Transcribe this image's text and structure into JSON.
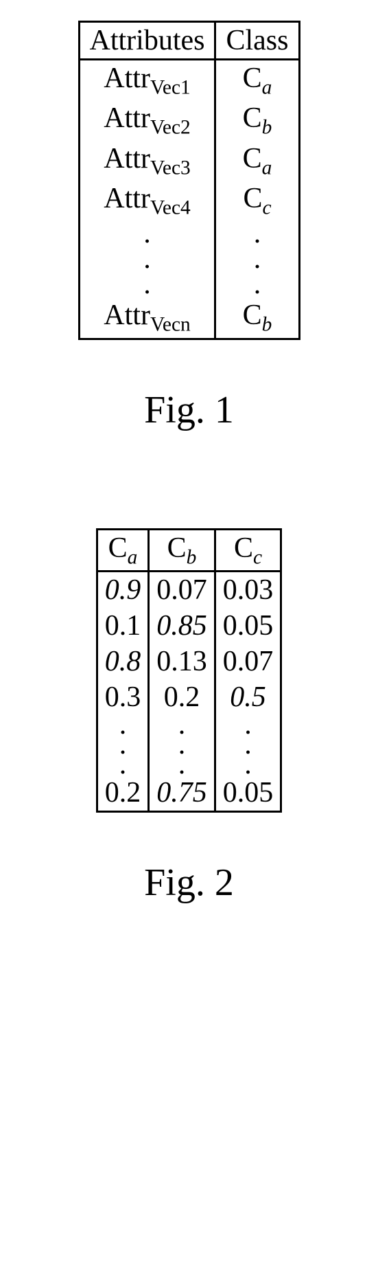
{
  "fig1": {
    "caption": "Fig. 1",
    "headers": [
      "Attributes",
      "Class"
    ],
    "rows": [
      {
        "attr_base": "Attr",
        "attr_sub": "Vec1",
        "cls_base": "C",
        "cls_sub": "a"
      },
      {
        "attr_base": "Attr",
        "attr_sub": "Vec2",
        "cls_base": "C",
        "cls_sub": "b"
      },
      {
        "attr_base": "Attr",
        "attr_sub": "Vec3",
        "cls_base": "C",
        "cls_sub": "a"
      },
      {
        "attr_base": "Attr",
        "attr_sub": "Vec4",
        "cls_base": "C",
        "cls_sub": "c"
      }
    ],
    "last_row": {
      "attr_base": "Attr",
      "attr_sub": "Vecn",
      "cls_base": "C",
      "cls_sub": "b"
    },
    "dot": "."
  },
  "fig2": {
    "caption": "Fig. 2",
    "headers": [
      {
        "base": "C",
        "sub": "a"
      },
      {
        "base": "C",
        "sub": "b"
      },
      {
        "base": "C",
        "sub": "c"
      }
    ],
    "rows": [
      {
        "ca": "0.9",
        "ca_it": true,
        "cb": "0.07",
        "cb_it": false,
        "cc": "0.03",
        "cc_it": false
      },
      {
        "ca": "0.1",
        "ca_it": false,
        "cb": "0.85",
        "cb_it": true,
        "cc": "0.05",
        "cc_it": false
      },
      {
        "ca": "0.8",
        "ca_it": true,
        "cb": "0.13",
        "cb_it": false,
        "cc": "0.07",
        "cc_it": false
      },
      {
        "ca": "0.3",
        "ca_it": false,
        "cb": "0.2",
        "cb_it": false,
        "cc": "0.5",
        "cc_it": true
      }
    ],
    "last_row": {
      "ca": "0.2",
      "ca_it": false,
      "cb": "0.75",
      "cb_it": true,
      "cc": "0.05",
      "cc_it": false
    },
    "dot": "."
  },
  "chart_data": [
    {
      "type": "table",
      "title": "Fig. 1",
      "columns": [
        "Attributes",
        "Class"
      ],
      "rows": [
        [
          "Attr_Vec1",
          "C_a"
        ],
        [
          "Attr_Vec2",
          "C_b"
        ],
        [
          "Attr_Vec3",
          "C_a"
        ],
        [
          "Attr_Vec4",
          "C_c"
        ],
        [
          "...",
          "..."
        ],
        [
          "Attr_Vecn",
          "C_b"
        ]
      ]
    },
    {
      "type": "table",
      "title": "Fig. 2",
      "columns": [
        "C_a",
        "C_b",
        "C_c"
      ],
      "rows": [
        [
          0.9,
          0.07,
          0.03
        ],
        [
          0.1,
          0.85,
          0.05
        ],
        [
          0.8,
          0.13,
          0.07
        ],
        [
          0.3,
          0.2,
          0.5
        ],
        [
          "...",
          "...",
          "..."
        ],
        [
          0.2,
          0.75,
          0.05
        ]
      ]
    }
  ]
}
